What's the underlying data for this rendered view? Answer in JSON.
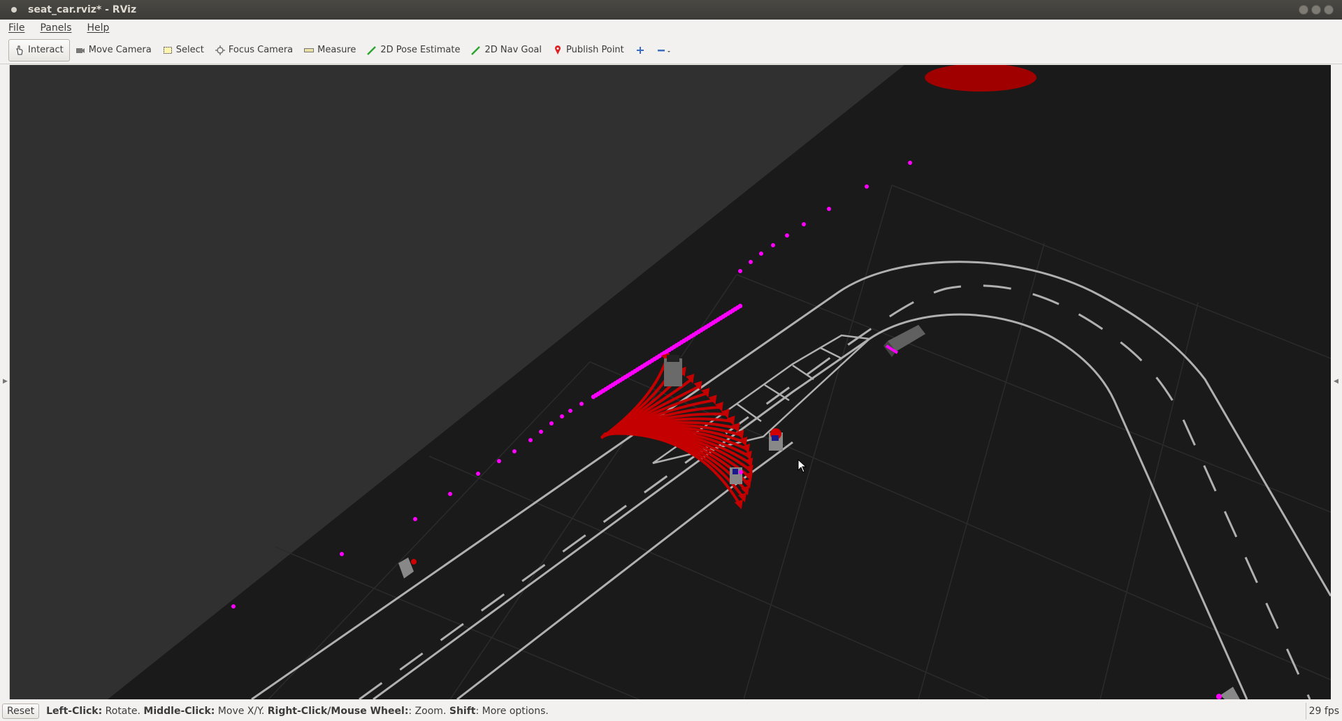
{
  "window": {
    "title": "seat_car.rviz* - RViz"
  },
  "menu": {
    "items": [
      "File",
      "Panels",
      "Help"
    ]
  },
  "toolbar": {
    "tools": [
      {
        "label": "Interact",
        "icon": "hand-pointer-icon",
        "active": true
      },
      {
        "label": "Move Camera",
        "icon": "move-camera-icon",
        "active": false
      },
      {
        "label": "Select",
        "icon": "select-box-icon",
        "active": false
      },
      {
        "label": "Focus Camera",
        "icon": "focus-camera-icon",
        "active": false
      },
      {
        "label": "Measure",
        "icon": "ruler-icon",
        "active": false
      },
      {
        "label": "2D Pose Estimate",
        "icon": "pose-arrow-green-icon",
        "active": false
      },
      {
        "label": "2D Nav Goal",
        "icon": "nav-goal-arrow-green-icon",
        "active": false
      },
      {
        "label": "Publish Point",
        "icon": "map-pin-red-icon",
        "active": false
      }
    ],
    "extra_icons": [
      "add-tool-plus-icon",
      "remove-tool-minus-icon"
    ]
  },
  "status": {
    "reset_label": "Reset",
    "hint_parts": [
      {
        "bold": "Left-Click:",
        "text": " Rotate. "
      },
      {
        "bold": "Middle-Click:",
        "text": " Move X/Y. "
      },
      {
        "bold": "Right-Click/Mouse Wheel:",
        "text": ": Zoom. "
      },
      {
        "bold": "Shift",
        "text": ": More options."
      }
    ],
    "fps": "29 fps"
  },
  "colors": {
    "background": "#303030",
    "ground": "#1a1a1a",
    "grid": "#2a2a2a",
    "lanes": "#b4b4b4",
    "pointcloud": "#ff00ff",
    "arrows": "#cc0000",
    "marker": "#a00000"
  }
}
